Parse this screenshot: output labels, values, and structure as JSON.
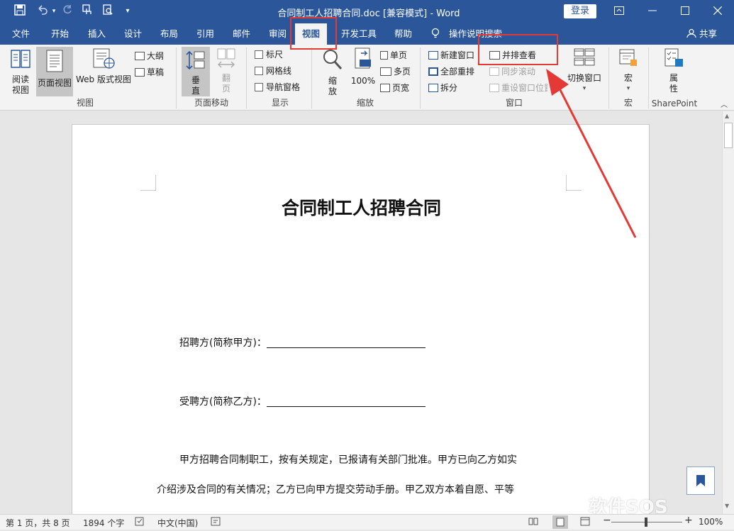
{
  "title_bar": {
    "document_title": "合同制工人招聘合同.doc [兼容模式]  -  Word",
    "login_label": "登录",
    "icons": [
      "save-icon",
      "undo-icon",
      "redo-icon",
      "touch-mode-icon",
      "print-preview-icon",
      "customize-qat-icon"
    ]
  },
  "menu": {
    "tabs": [
      "文件",
      "开始",
      "插入",
      "设计",
      "布局",
      "引用",
      "邮件",
      "审阅",
      "视图",
      "开发工具",
      "帮助"
    ],
    "active_tab": "视图",
    "tell_me": "操作说明搜索",
    "share": "共享"
  },
  "ribbon": {
    "views": {
      "read_mode": "阅读\n视图",
      "read_line1": "阅读",
      "read_line2": "视图",
      "print_layout": "页面视图",
      "web_layout": "Web 版式视图",
      "outline": "大纲",
      "draft": "草稿",
      "group_label": "视图"
    },
    "page_move": {
      "vertical_l1": "垂",
      "vertical_l2": "直",
      "flip_l1": "翻",
      "flip_l2": "页",
      "group_label": "页面移动"
    },
    "show": {
      "ruler": "标尺",
      "gridlines": "网格线",
      "nav_pane": "导航窗格",
      "group_label": "显示"
    },
    "zoom": {
      "zoom_l1": "缩",
      "zoom_l2": "放",
      "hundred": "100%",
      "one_page": "单页",
      "multi_page": "多页",
      "page_width": "页宽",
      "group_label": "缩放"
    },
    "window": {
      "new_window": "新建窗口",
      "arrange_all": "全部重排",
      "split": "拆分",
      "side_by_side": "并排查看",
      "sync_scroll": "同步滚动",
      "reset_position": "重设窗口位置",
      "switch_window": "切换窗口",
      "group_label": "窗口"
    },
    "macros": {
      "macro_label": "宏",
      "group_label": "宏"
    },
    "sharepoint": {
      "props_l1": "属",
      "props_l2": "性",
      "group_label": "SharePoint"
    }
  },
  "document": {
    "title": "合同制工人招聘合同",
    "employer_label": "招聘方(简称甲方)：",
    "employee_label": "受聘方(简称乙方)：",
    "para_line1": "甲方招聘合同制职工，按有关规定，已报请有关部门批准。甲方已向乙方如实",
    "para_line2": "介绍涉及合同的有关情况；乙方已向甲方提交劳动手册。甲乙双方本着自愿、平等"
  },
  "status_bar": {
    "page": "第 1 页，共 8 页",
    "words": "1894 个字",
    "language": "中文(中国)",
    "zoom": "100%"
  },
  "watermark": "软件SOS",
  "colors": {
    "accent": "#2b579a",
    "highlight_box": "#e53935"
  }
}
